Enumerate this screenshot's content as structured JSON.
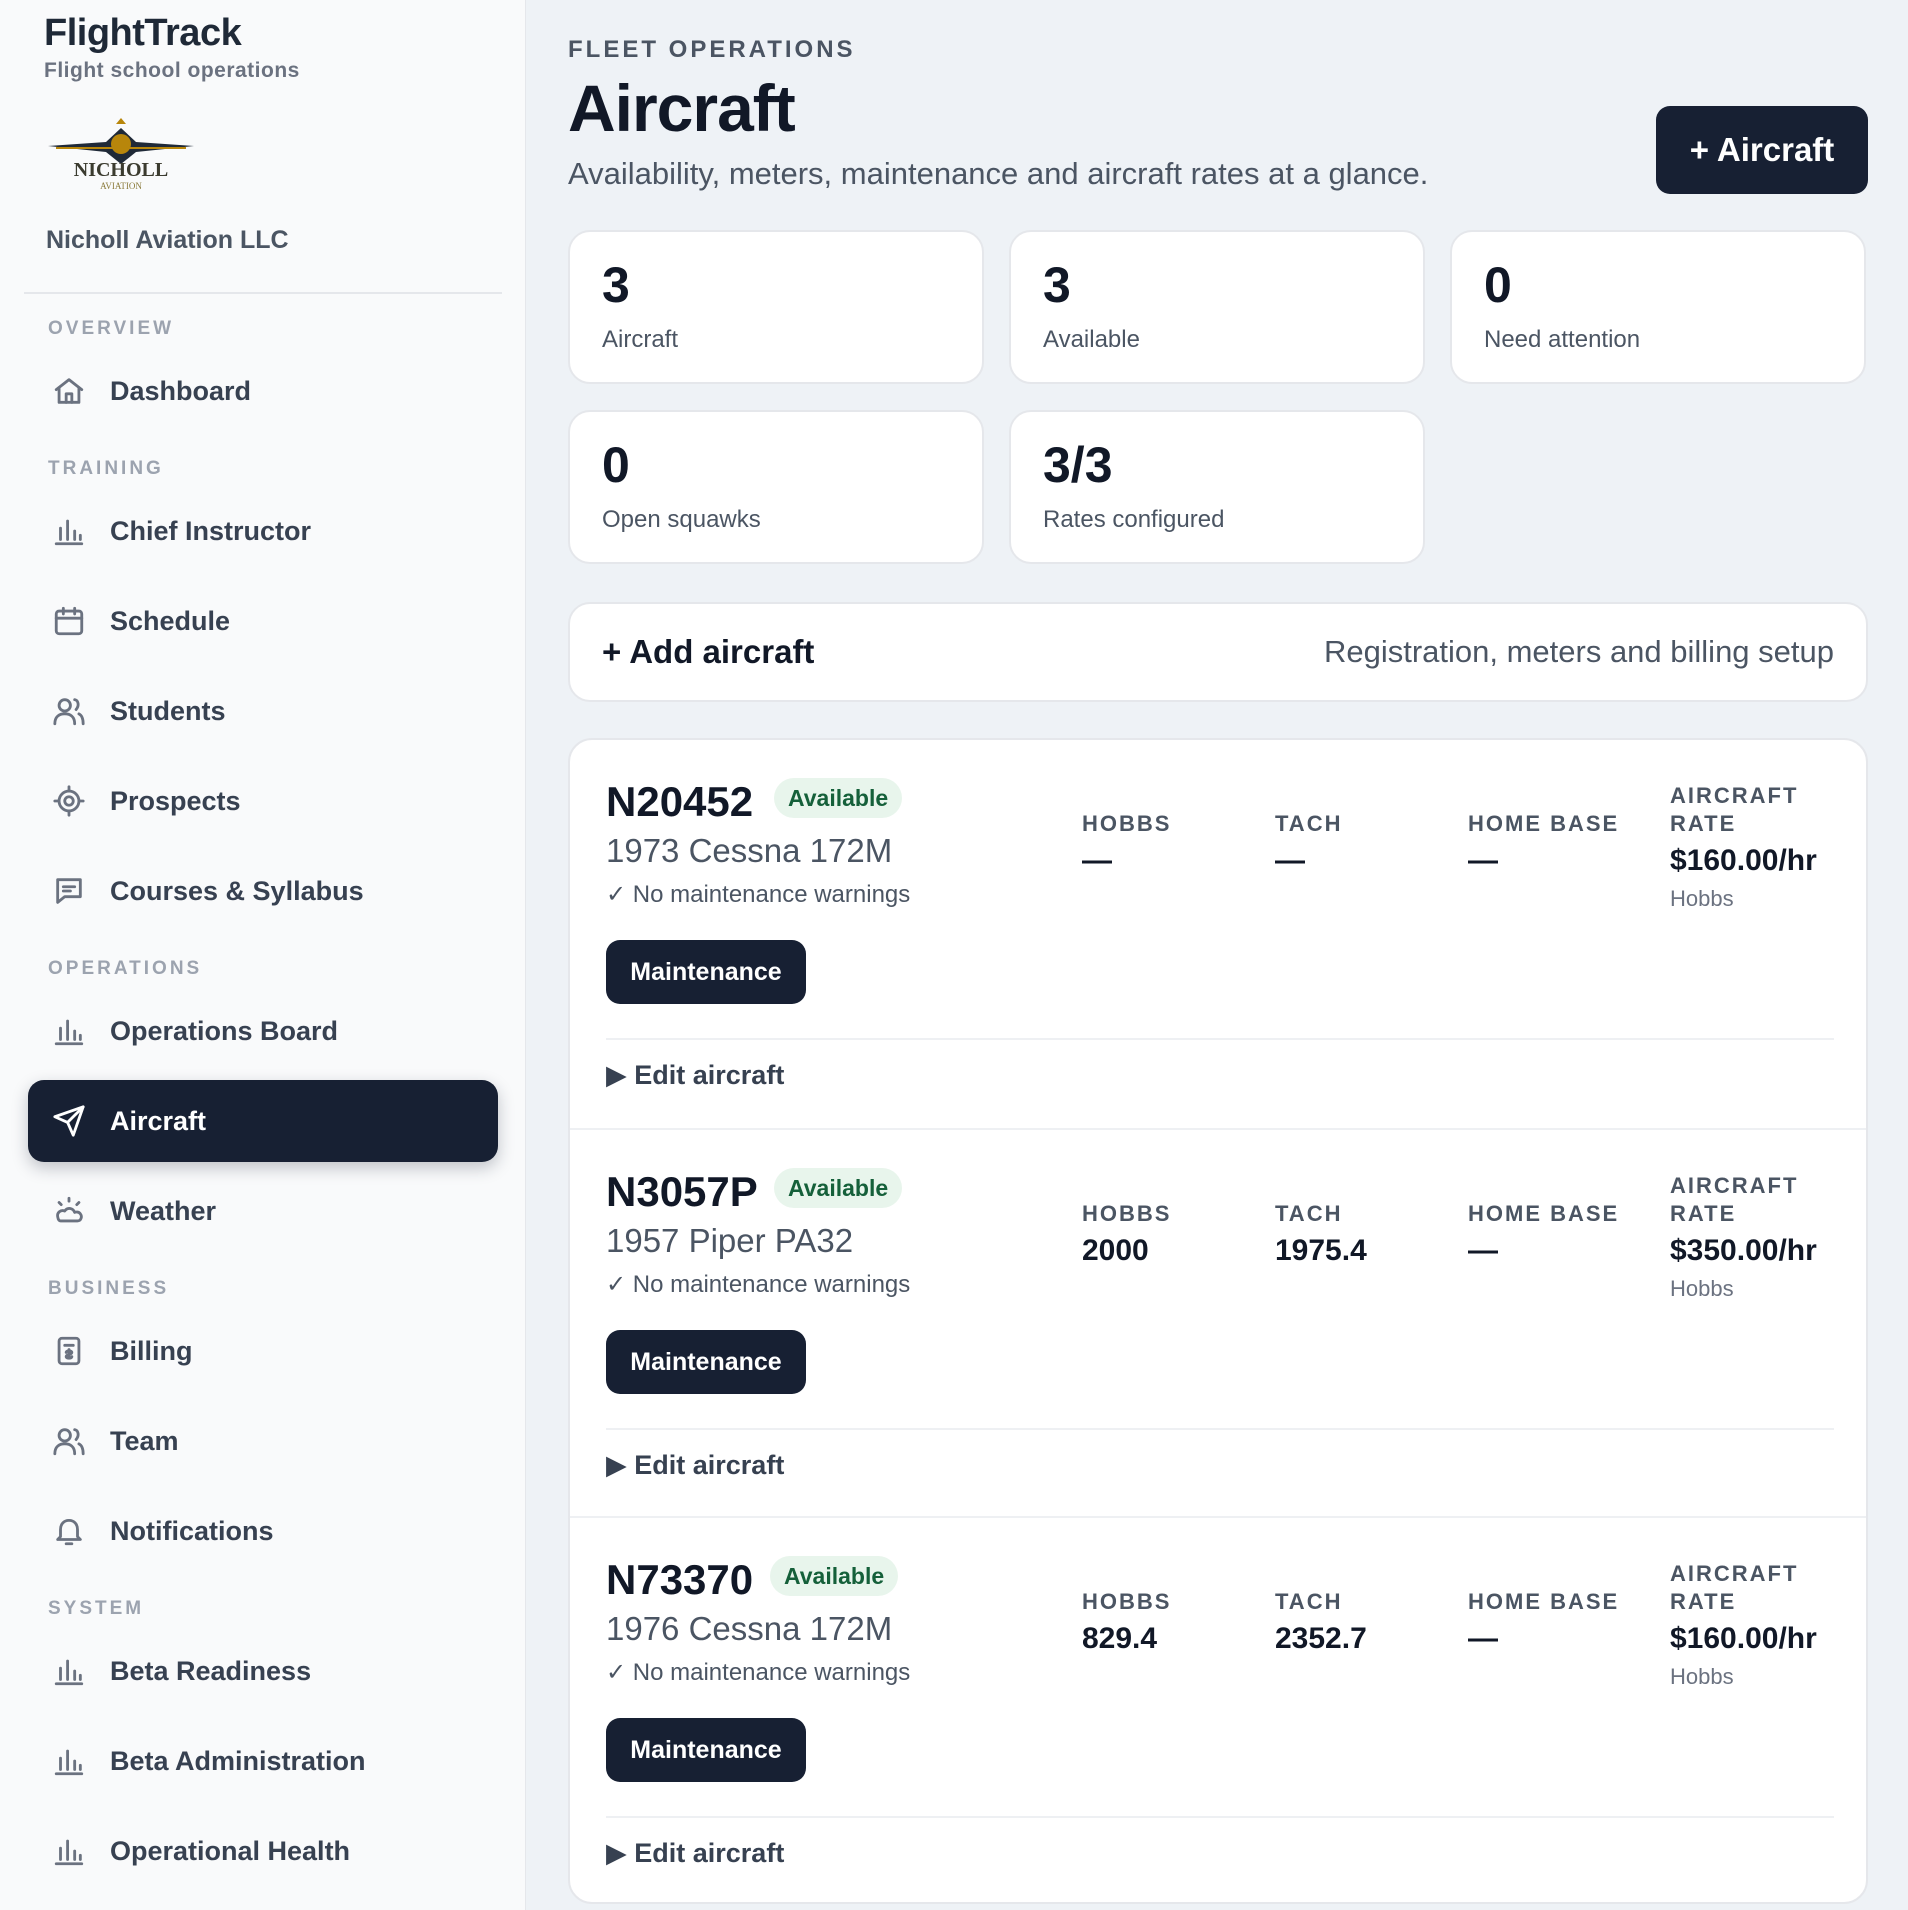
{
  "brand": {
    "title": "FlightTrack",
    "subtitle": "Flight school operations"
  },
  "org": {
    "name": "Nicholl Aviation LLC"
  },
  "nav": {
    "sections": {
      "overview": "OVERVIEW",
      "training": "TRAINING",
      "operations": "OPERATIONS",
      "business": "BUSINESS",
      "system": "SYSTEM"
    },
    "items": {
      "dashboard": "Dashboard",
      "chief_instructor": "Chief Instructor",
      "schedule": "Schedule",
      "students": "Students",
      "prospects": "Prospects",
      "courses": "Courses & Syllabus",
      "operations_board": "Operations Board",
      "aircraft": "Aircraft",
      "weather": "Weather",
      "billing": "Billing",
      "team": "Team",
      "notifications": "Notifications",
      "beta_readiness": "Beta Readiness",
      "beta_admin": "Beta Administration",
      "operational_health": "Operational Health"
    },
    "active": "aircraft"
  },
  "header": {
    "eyebrow": "FLEET OPERATIONS",
    "title": "Aircraft",
    "subtitle": "Availability, meters, maintenance and aircraft rates at a glance.",
    "add_button": "+ Aircraft"
  },
  "stats": [
    {
      "value": "3",
      "label": "Aircraft"
    },
    {
      "value": "3",
      "label": "Available"
    },
    {
      "value": "0",
      "label": "Need attention"
    },
    {
      "value": "0",
      "label": "Open squawks"
    },
    {
      "value": "3/3",
      "label": "Rates configured"
    }
  ],
  "add_row": {
    "label": "+ Add aircraft",
    "hint": "Registration, meters and billing setup"
  },
  "labels": {
    "hobbs": "HOBBS",
    "tach": "TACH",
    "home_base": "HOME BASE",
    "rate": "AIRCRAFT RATE",
    "maintenance": "Maintenance",
    "edit": "▶ Edit aircraft"
  },
  "aircraft": [
    {
      "reg": "N20452",
      "status": "Available",
      "model": "1973 Cessna 172M",
      "warning": "✓ No maintenance warnings",
      "hobbs": "—",
      "tach": "—",
      "home_base": "—",
      "rate": "$160.00/hr",
      "rate_basis": "Hobbs"
    },
    {
      "reg": "N3057P",
      "status": "Available",
      "model": "1957 Piper PA32",
      "warning": "✓ No maintenance warnings",
      "hobbs": "2000",
      "tach": "1975.4",
      "home_base": "—",
      "rate": "$350.00/hr",
      "rate_basis": "Hobbs"
    },
    {
      "reg": "N73370",
      "status": "Available",
      "model": "1976 Cessna 172M",
      "warning": "✓ No maintenance warnings",
      "hobbs": "829.4",
      "tach": "2352.7",
      "home_base": "—",
      "rate": "$160.00/hr",
      "rate_basis": "Hobbs"
    }
  ],
  "colors": {
    "accent": "#172033",
    "available_bg": "#e8f5ec",
    "available_text": "#15603a"
  }
}
